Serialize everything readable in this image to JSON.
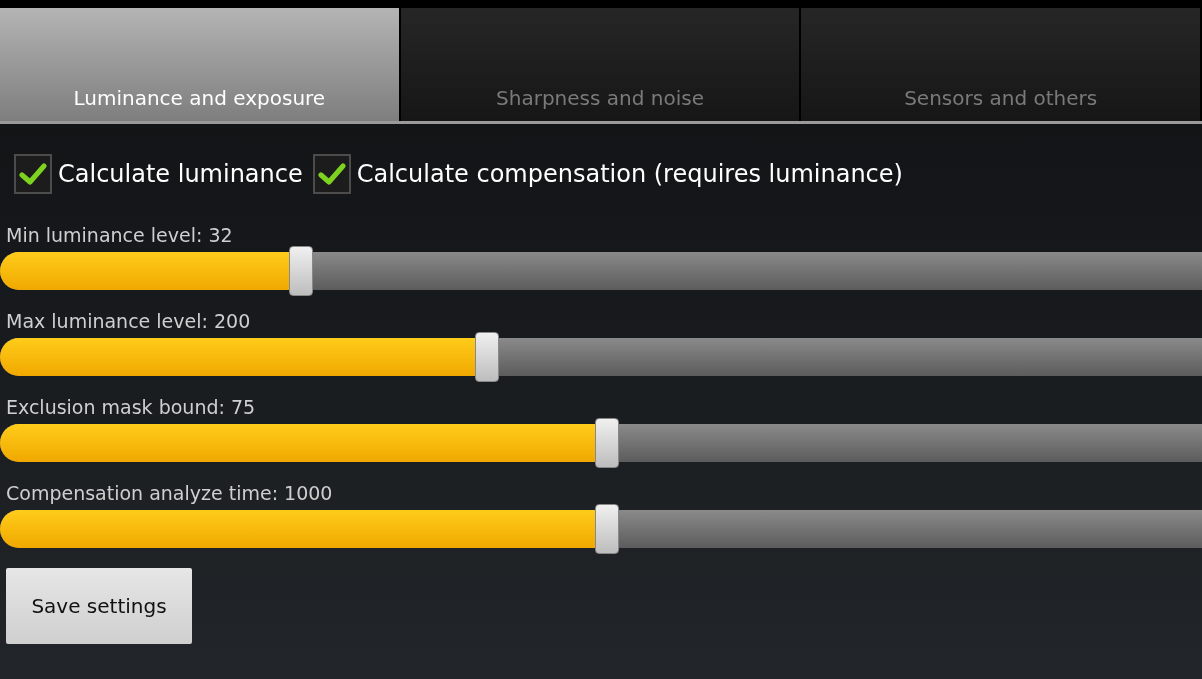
{
  "tabs": [
    {
      "label": "Luminance and exposure",
      "selected": true
    },
    {
      "label": "Sharpness and noise",
      "selected": false
    },
    {
      "label": "Sensors and others",
      "selected": false
    }
  ],
  "checkboxes": [
    {
      "label": "Calculate luminance",
      "checked": true
    },
    {
      "label": "Calculate compensation (requires luminance)",
      "checked": true
    }
  ],
  "sliders": [
    {
      "label": "Min luminance level: 32",
      "level": 0.25
    },
    {
      "label": "Max luminance level: 200",
      "level": 0.405
    },
    {
      "label": "Exclusion mask bound: 75",
      "level": 0.505
    },
    {
      "label": "Compensation analyze time: 1000",
      "level": 0.505
    }
  ],
  "buttons": [
    "Save settings"
  ]
}
